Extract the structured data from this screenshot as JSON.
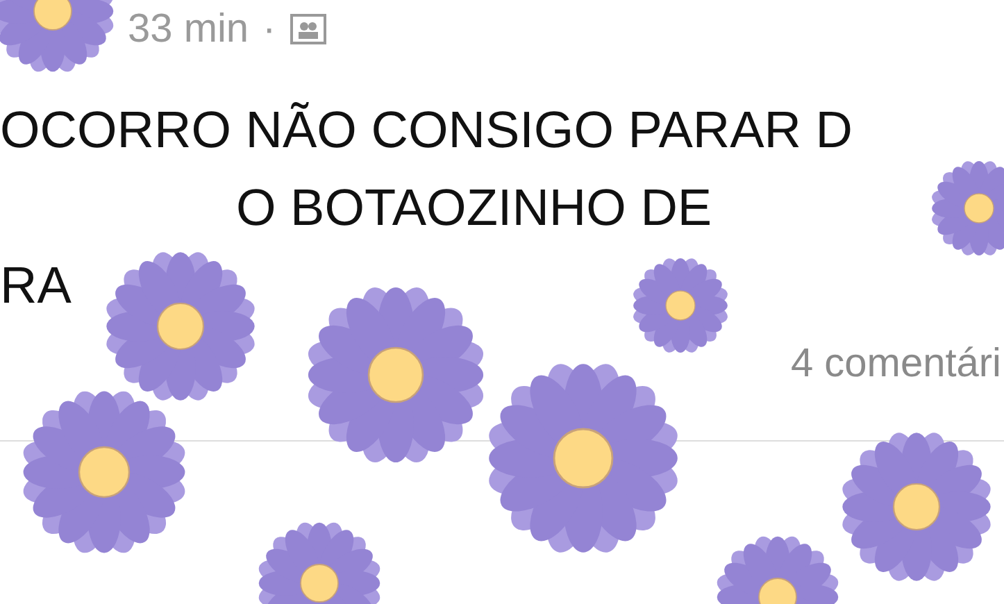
{
  "post": {
    "time": "33 min",
    "separator": "·",
    "text_lines": [
      "OCORRO NÃO CONSIGO PARAR D",
      "O BOTAOZINHO DE",
      "RA"
    ],
    "comments": "4 comentári"
  }
}
